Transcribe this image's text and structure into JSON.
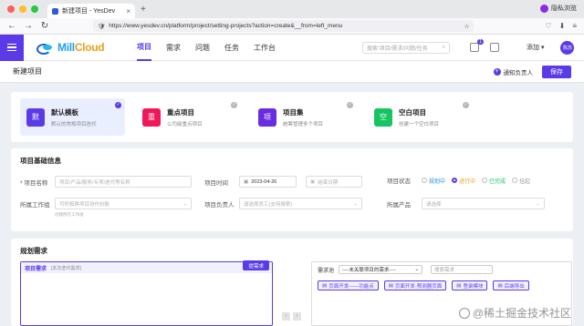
{
  "browser": {
    "tab_title": "新建项目 - YesDev",
    "url": "https://www.yesdev.cn/platform/project/setting-projects?action=create&__from=left_menu",
    "private_label": "隐私浏览"
  },
  "header": {
    "logo": "MillCloud",
    "nav": [
      "项目",
      "需求",
      "问题",
      "任务",
      "工作台"
    ],
    "search_placeholder": "搜索:项目/需求/问题/任务",
    "notification_count": "1",
    "add_label": "添加",
    "avatar_label": "陈苏"
  },
  "titlebar": {
    "title": "新建项目",
    "notify_label": "通知负责人",
    "save_label": "保存"
  },
  "templates": [
    {
      "icon": "默",
      "name": "默认模板",
      "desc": "默认的常规项目迭代",
      "color": "#5b3ae8",
      "selected": true
    },
    {
      "icon": "重",
      "name": "重点项目",
      "desc": "公司级重点项目",
      "color": "#f0185a",
      "selected": false
    },
    {
      "icon": "项",
      "name": "项目集",
      "desc": "统筹管理多个项目",
      "color": "#6a2ce0",
      "selected": false
    },
    {
      "icon": "空",
      "name": "空白项目",
      "desc": "创建一个空白项目",
      "color": "#17c464",
      "selected": false
    }
  ],
  "basic_info": {
    "section_title": "项目基础信息",
    "name_label": "* 项目名称",
    "name_placeholder": "项目/产品/服务/专项/迭代等名称",
    "time_label": "项目时间",
    "start_date": "2023-04-26",
    "end_placeholder": "结束日期",
    "status_label": "项目状态",
    "status_options": [
      "规划中",
      "进行中",
      "已完成",
      "挂起"
    ],
    "status_selected": "进行中",
    "group_label": "所属工作组",
    "group_placeholder": "可积极跨项目协作抗衡",
    "group_hint": "创建所在工作组",
    "owner_label": "项目负责人",
    "owner_placeholder": "请选择员工(支持搜索)",
    "product_label": "所属产品",
    "product_placeholder": "请选择"
  },
  "planning": {
    "section_title": "规划需求",
    "req_title": "项目需求",
    "req_sub": "[本次迭代需求]",
    "plan_button": "提需求",
    "pool_label": "需求池",
    "pool_select": "----未关联项目的需求----",
    "pool_search_placeholder": "搜索需求",
    "chips": [
      "页面开发——功能点",
      "页面开发-预测器页面",
      "登录模块",
      "后端导出"
    ],
    "watermark": "@稀土掘金技术社区"
  }
}
